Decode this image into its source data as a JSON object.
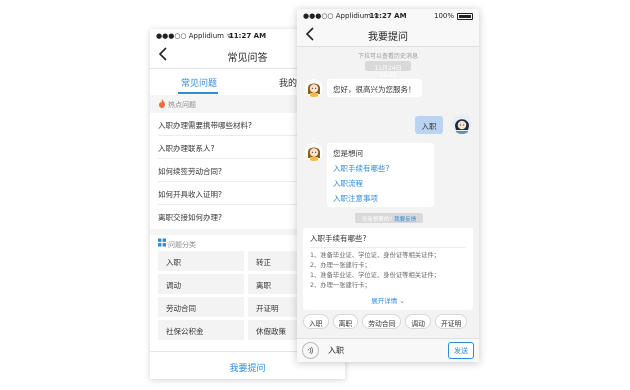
{
  "left_phone": {
    "status": {
      "carrier": "●●●○○ Applidium ᯤ",
      "time": "11:27 AM"
    },
    "navbar": {
      "back_icon": "chevron-left-icon",
      "title": "常见问答"
    },
    "tabs": [
      {
        "label": "常见问题",
        "active": true
      },
      {
        "label": "我的提问",
        "active": false
      }
    ],
    "hot_section": {
      "icon": "flame-icon",
      "label": "热点问题"
    },
    "faq_items": [
      "入职办理需要携带哪些材料?",
      "入职办理联系人?",
      "如何续签劳动合同?",
      "如何开具收入证明?",
      "离职交接如何办理?"
    ],
    "category_section": {
      "icon": "grid-icon",
      "label": "问题分类"
    },
    "categories": [
      "入职",
      "转正",
      "调动",
      "离职",
      "劳动合同",
      "开证明",
      "社保公积金",
      "休假政策"
    ],
    "ask_button": "我要提问",
    "accent": "#2f8ad8"
  },
  "right_phone": {
    "status": {
      "carrier": "●●●○○ Applidium ᯤ",
      "time": "11:27 AM",
      "battery": "100%"
    },
    "navbar": {
      "back_icon": "chevron-left-icon",
      "title": "我要提问"
    },
    "pull_hint": "下拉可以查看历史消息",
    "timestamp": "11月24日 14:46",
    "bot_greeting": "您好，很高兴为您服务！",
    "user_message": "入职",
    "bot_choice": {
      "question": "您是想问",
      "options": [
        "入职手续有哪些?",
        "入职流程",
        "入职注意事项"
      ]
    },
    "rate_note": {
      "text": "没有想要的?",
      "link": "我要反馈"
    },
    "answer_card": {
      "title": "入职手续有哪些?",
      "lines": [
        "1、准备毕业证、学位证、身份证等相关证件；",
        "2、办理一张建行卡；",
        "1、准备毕业证、学位证、身份证等相关证件；",
        "2、办理一张建行卡；"
      ],
      "expand_label": "展开详情 ⌄"
    },
    "quick_tags": [
      "入职",
      "离职",
      "劳动合同",
      "调动",
      "开证明"
    ],
    "input": {
      "voice_icon": "voice-icon",
      "value": "入职",
      "send_label": "发送"
    },
    "bubble_color": "#b9d4f2"
  }
}
